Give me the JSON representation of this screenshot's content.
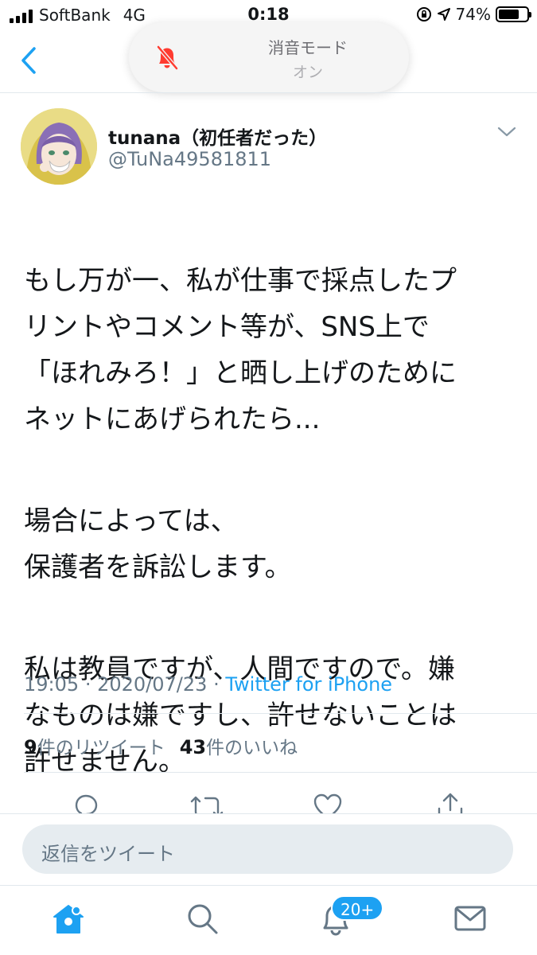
{
  "status_bar": {
    "carrier": "SoftBank",
    "network": "4G",
    "time": "0:18",
    "battery_percent": "74%",
    "battery_level": 0.74
  },
  "toast": {
    "title": "消音モード",
    "subtitle": "オン",
    "icon": "bell-slash-icon"
  },
  "tweet": {
    "display_name": "tunana（初任者だった）",
    "handle": "@TuNa49581811",
    "paragraphs": [
      "もし万が一、私が仕事で採点したプ\nリントやコメント等が、SNS上で\n「ほれみろ！」と晒し上げのために\nネットにあげられたら...",
      "場合によっては、\n保護者を訴訟します。",
      "私は教員ですが、人間ですので。嫌\nなものは嫌ですし、許せないことは\n許せません。"
    ],
    "time": "19:05",
    "date": "2020/07/23",
    "separator": "·",
    "source": "Twitter for iPhone",
    "retweet_count": "9",
    "retweet_label": "件のリツイート",
    "like_count": "43",
    "like_label": "件のいいね"
  },
  "reply": {
    "placeholder": "返信をツイート"
  },
  "tabbar": {
    "notifications_badge": "20+"
  },
  "colors": {
    "accent": "#1da1f2",
    "secondary_text": "#657786",
    "mute_red": "#ff3b30"
  }
}
